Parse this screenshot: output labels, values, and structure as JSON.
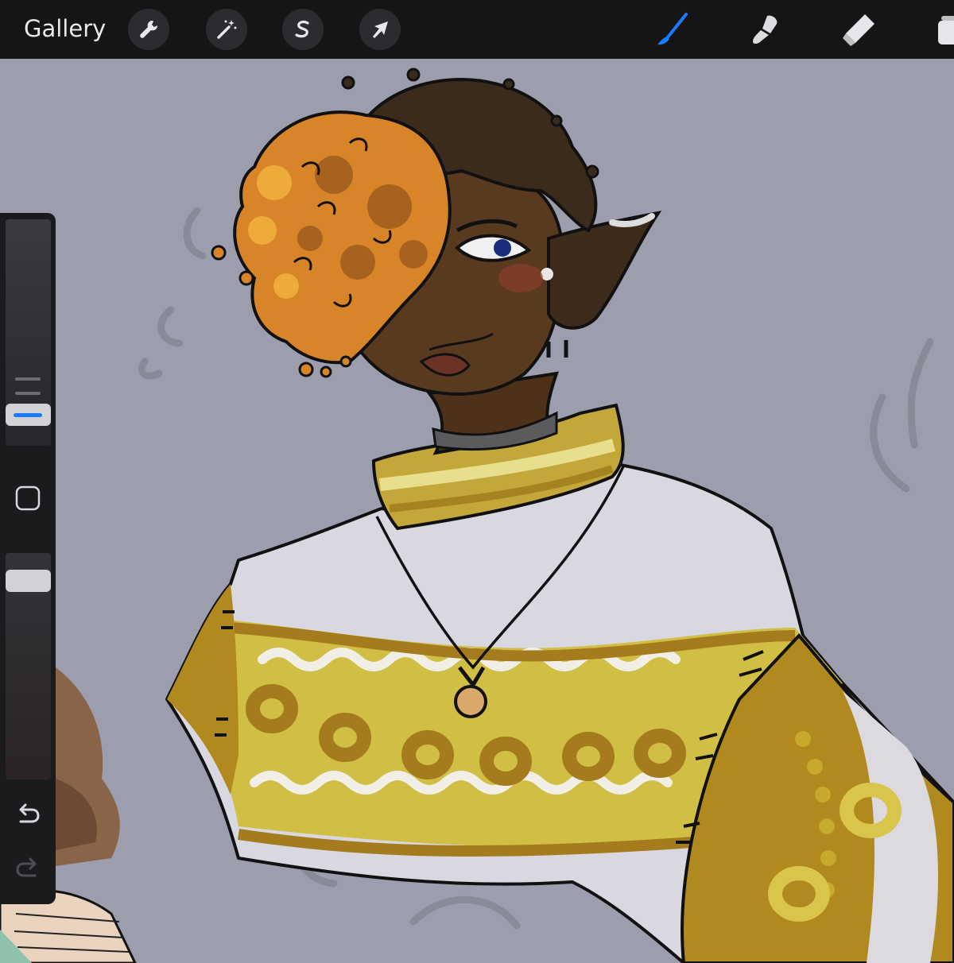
{
  "toolbar": {
    "gallery_label": "Gallery",
    "left_tools": [
      "wrench-icon",
      "magic-wand-icon",
      "selection-s-icon",
      "arrow-cursor-icon"
    ],
    "right_tools": [
      "brush-icon",
      "smudge-icon",
      "eraser-icon",
      "layers-icon"
    ],
    "active_tool": "brush",
    "accent_color": "#1a7bff"
  },
  "sidebar": {
    "brush_size_level": 0.16,
    "opacity_level": 0.84,
    "icons": [
      "modify-square-icon",
      "undo-icon",
      "redo-icon"
    ]
  },
  "canvas": {
    "background_color": "#9c9ead"
  }
}
